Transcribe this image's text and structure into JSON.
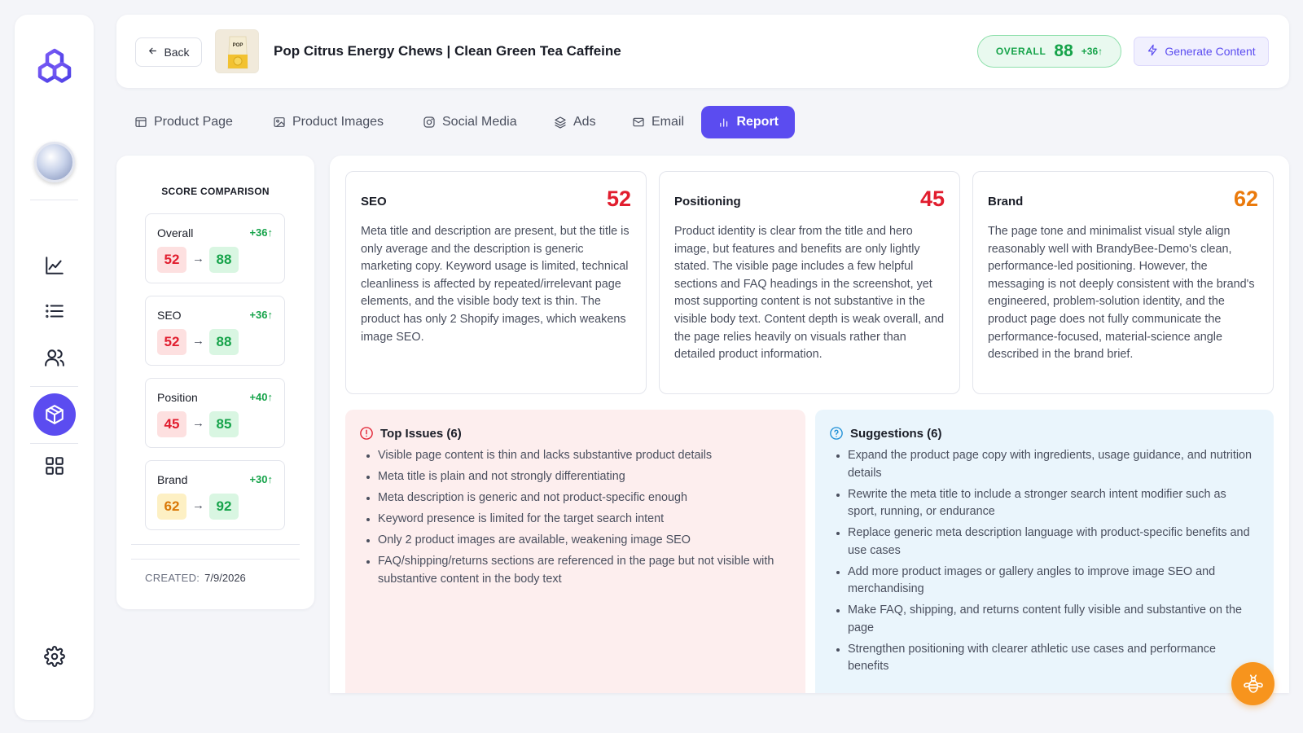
{
  "header": {
    "back_label": "Back",
    "product_title": "Pop Citrus Energy Chews | Clean Green Tea Caffeine",
    "thumb_label": "POP",
    "overall": {
      "label": "OVERALL",
      "value": "88",
      "delta": "+36"
    },
    "generate_label": "Generate Content"
  },
  "tabs": [
    {
      "label": "Product Page",
      "icon": "layout-icon"
    },
    {
      "label": "Product Images",
      "icon": "image-icon"
    },
    {
      "label": "Social Media",
      "icon": "instagram-icon"
    },
    {
      "label": "Ads",
      "icon": "layers-icon"
    },
    {
      "label": "Email",
      "icon": "mail-icon"
    },
    {
      "label": "Report",
      "icon": "bar-chart-icon",
      "active": true
    }
  ],
  "score_comparison": {
    "title": "SCORE COMPARISON",
    "items": [
      {
        "label": "Overall",
        "delta": "+36",
        "old": "52",
        "new": "88"
      },
      {
        "label": "SEO",
        "delta": "+36",
        "old": "52",
        "new": "88"
      },
      {
        "label": "Position",
        "delta": "+40",
        "old": "45",
        "new": "85"
      },
      {
        "label": "Brand",
        "delta": "+30",
        "old": "62",
        "new": "92"
      }
    ],
    "created_label": "CREATED:",
    "created_value": "7/9/2026"
  },
  "metrics": [
    {
      "name": "SEO",
      "score": "52",
      "text": "Meta title and description are present, but the title is only average and the description is generic marketing copy. Keyword usage is limited, technical cleanliness is affected by repeated/irrelevant page elements, and the visible body text is thin. The product has only 2 Shopify images, which weakens image SEO."
    },
    {
      "name": "Positioning",
      "score": "45",
      "text": "Product identity is clear from the title and hero image, but features and benefits are only lightly stated. The visible page includes a few helpful sections and FAQ headings in the screenshot, yet most supporting content is not substantive in the visible body text. Content depth is weak overall, and the page relies heavily on visuals rather than detailed product information."
    },
    {
      "name": "Brand",
      "score": "62",
      "text": "The page tone and minimalist visual style align reasonably well with BrandyBee-Demo's clean, performance-led positioning. However, the messaging is not deeply consistent with the brand's engineered, problem-solution identity, and the product page does not fully communicate the performance-focused, material-science angle described in the brand brief."
    }
  ],
  "issues": {
    "title": "Top Issues (6)",
    "items": [
      "Visible page content is thin and lacks substantive product details",
      "Meta title is plain and not strongly differentiating",
      "Meta description is generic and not product-specific enough",
      "Keyword presence is limited for the target search intent",
      "Only 2 product images are available, weakening image SEO",
      "FAQ/shipping/returns sections are referenced in the page but not visible with substantive content in the body text"
    ]
  },
  "suggestions": {
    "title": "Suggestions (6)",
    "items": [
      "Expand the product page copy with ingredients, usage guidance, and nutrition details",
      "Rewrite the meta title to include a stronger search intent modifier such as sport, running, or endurance",
      "Replace generic meta description language with product-specific benefits and use cases",
      "Add more product images or gallery angles to improve image SEO and merchandising",
      "Make FAQ, shipping, and returns content fully visible and substantive on the page",
      "Strengthen positioning with clearer athletic use cases and performance benefits"
    ]
  },
  "colors": {
    "accent": "#5b4cf0",
    "success": "#16a34a",
    "danger": "#e11d2e",
    "warning": "#ea7a0c",
    "fab": "#f7941d"
  }
}
